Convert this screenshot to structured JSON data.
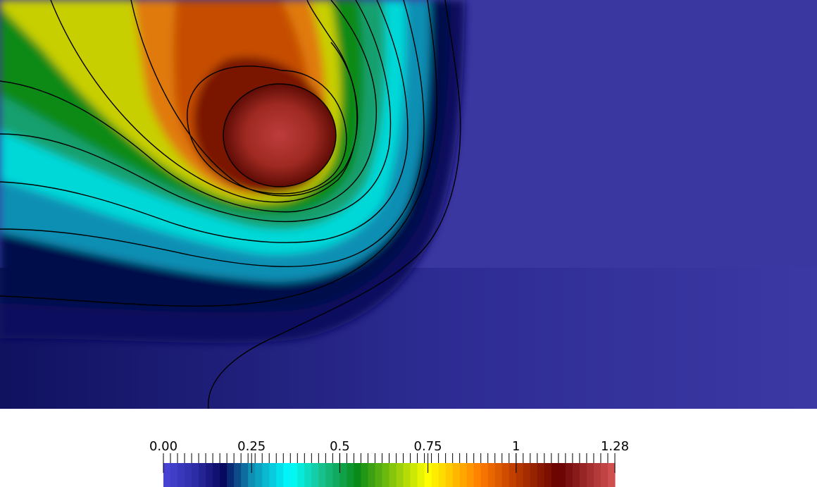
{
  "colorbar": {
    "range": [
      0.0,
      1.28
    ],
    "discrete_bands": 64,
    "tick_labels": [
      {
        "text": "0.00",
        "value": 0.0
      },
      {
        "text": "0.25",
        "value": 0.25
      },
      {
        "text": "0.5",
        "value": 0.5
      },
      {
        "text": "0.75",
        "value": 0.75
      },
      {
        "text": "1",
        "value": 1.0
      },
      {
        "text": "1.28",
        "value": 1.28
      }
    ],
    "color_stops": [
      {
        "value": 0.0,
        "color": "#4a45d8"
      },
      {
        "value": 0.09,
        "color": "#2c2ca6"
      },
      {
        "value": 0.17,
        "color": "#07085e"
      },
      {
        "value": 0.25,
        "color": "#0f8fb4"
      },
      {
        "value": 0.36,
        "color": "#00ffff"
      },
      {
        "value": 0.45,
        "color": "#18c08c"
      },
      {
        "value": 0.55,
        "color": "#0a8a18"
      },
      {
        "value": 0.75,
        "color": "#ffff00"
      },
      {
        "value": 0.9,
        "color": "#ff7a00"
      },
      {
        "value": 1.0,
        "color": "#ba3a00"
      },
      {
        "value": 1.12,
        "color": "#660000"
      },
      {
        "value": 1.28,
        "color": "#d65454"
      }
    ]
  },
  "field": {
    "background_color": "#3b37a1"
  }
}
